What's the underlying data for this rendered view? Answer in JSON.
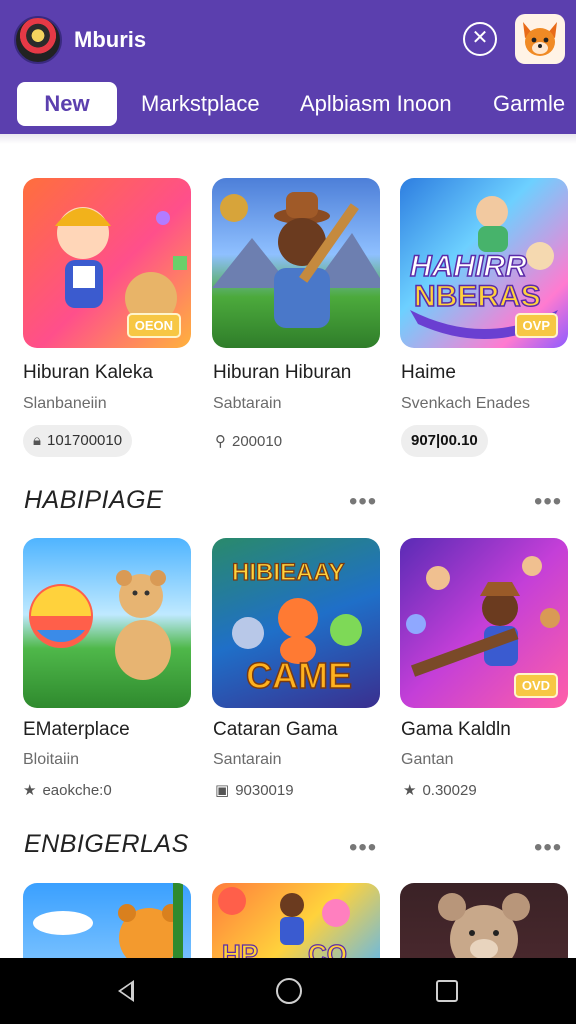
{
  "header": {
    "app_name": "Mburis",
    "tabs": [
      {
        "label": "New"
      },
      {
        "label": "Markstplace"
      },
      {
        "label": "Aplbiasm Inoon"
      },
      {
        "label": "Garmle"
      }
    ],
    "close_icon": "close-circle-icon",
    "avatar_icon": "fox-avatar"
  },
  "row1": [
    {
      "title": "Hiburan Kaleka",
      "subtitle": "Slanbaneiin",
      "meta": "101700010",
      "meta_icon": "lock-icon",
      "badge": "OEON"
    },
    {
      "title": "Hiburan Hiburan",
      "subtitle": "Sabtarain",
      "meta": "200010",
      "meta_icon": "location-icon",
      "badge": ""
    },
    {
      "title": "Haime",
      "subtitle": "Svenkach Enades",
      "meta": "907|00.10",
      "meta_icon": "",
      "badge": "OVP",
      "thumb_text": [
        "HAHIRR",
        "NBERAS"
      ]
    }
  ],
  "section2": {
    "title": "HABIPIAGE",
    "more": "•••"
  },
  "row2": [
    {
      "title": "EMaterplace",
      "subtitle": "Bloitaiin",
      "meta": "eaokche:0",
      "meta_icon": "star-icon",
      "badge": ""
    },
    {
      "title": "Cataran Gama",
      "subtitle": "Santarain",
      "meta": "9030019",
      "meta_icon": "calendar-icon",
      "badge": "",
      "thumb_text": [
        "HIBIEAAY",
        "CAME"
      ]
    },
    {
      "title": "Gama Kaldln",
      "subtitle": "Gantan",
      "meta": "0.30029",
      "meta_icon": "star-icon",
      "badge": "OVD"
    }
  ],
  "section3": {
    "title": "ENBIGERLAS",
    "more": "•••"
  },
  "row3_partial": [
    {
      "thumb_text": [
        "HP",
        "CO"
      ]
    }
  ],
  "colors": {
    "header": "#5b3fae",
    "badge": "#f7c744"
  }
}
